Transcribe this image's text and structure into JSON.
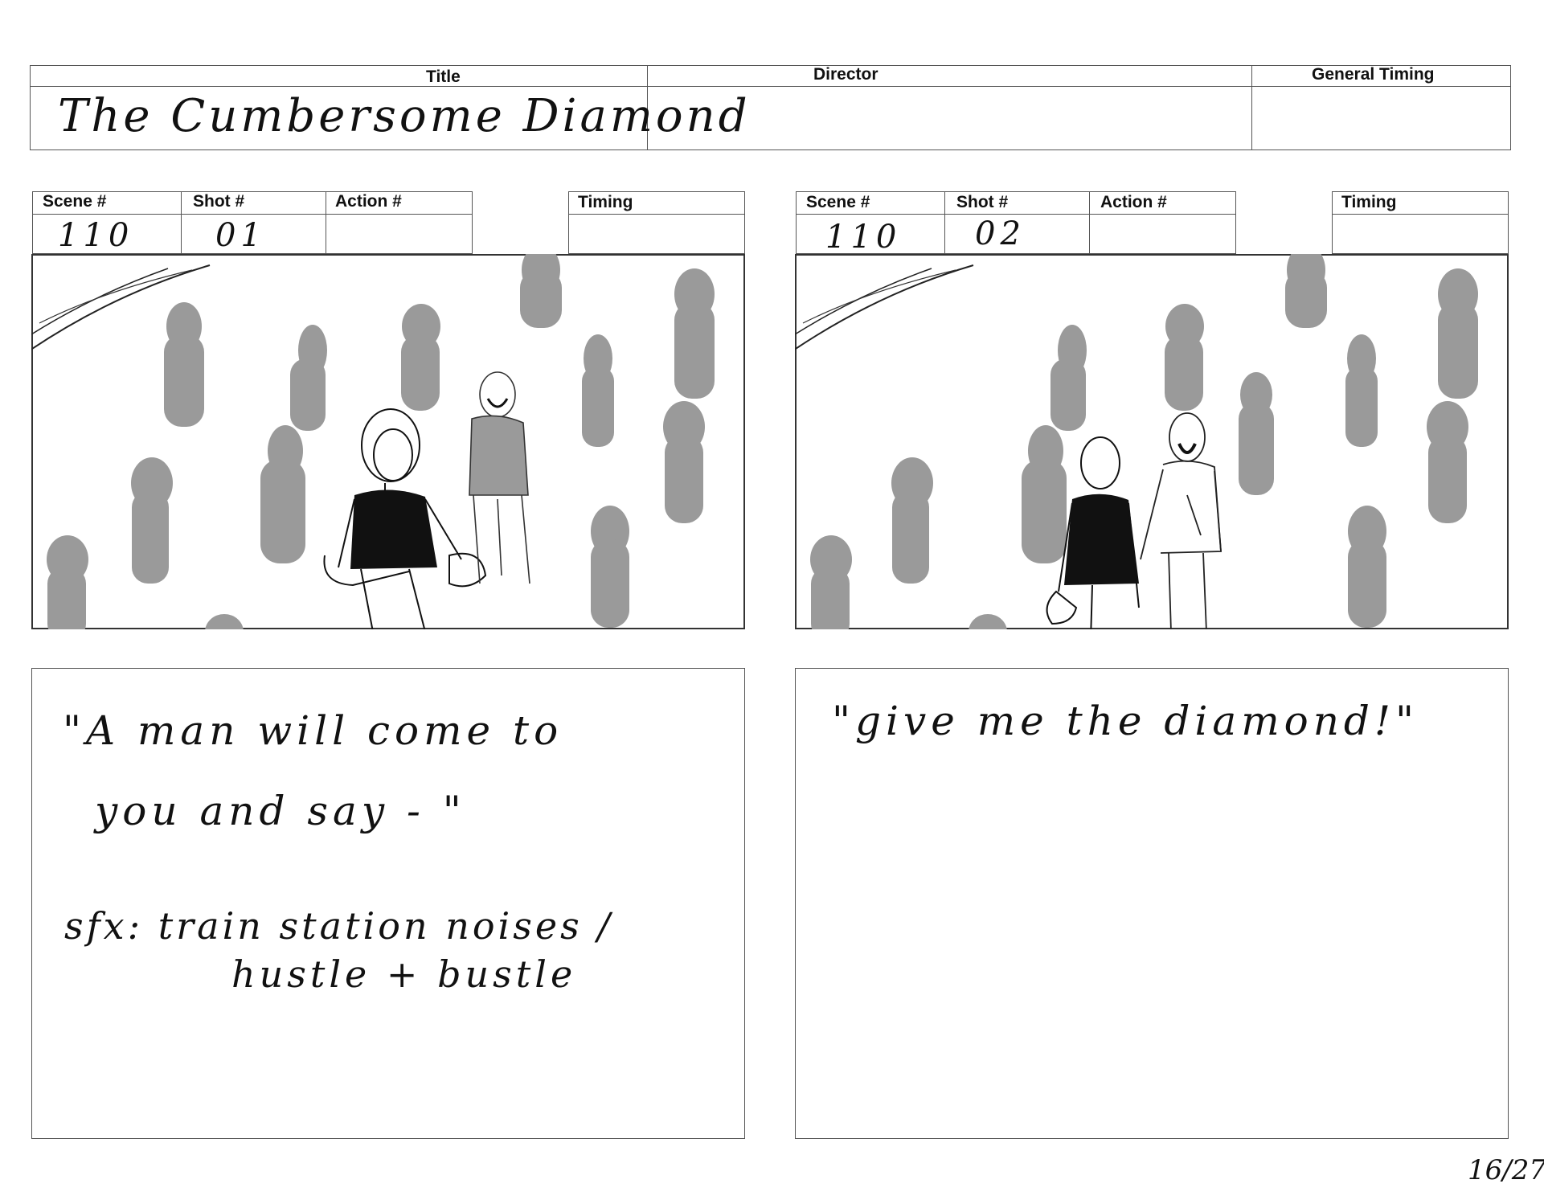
{
  "header": {
    "title_label": "Title",
    "director_label": "Director",
    "general_timing_label": "General Timing",
    "title_value": "The Cumbersome Diamond",
    "director_value": "",
    "general_timing_value": ""
  },
  "panels": [
    {
      "scene_label": "Scene #",
      "shot_label": "Shot #",
      "action_label": "Action #",
      "timing_label": "Timing",
      "scene_value": "110",
      "shot_value": "01",
      "action_value": "",
      "timing_value": "",
      "notes": [
        "\"A man will come to",
        "you and say - \"",
        "sfx: train station noises /",
        "hustle + bustle"
      ]
    },
    {
      "scene_label": "Scene #",
      "shot_label": "Shot #",
      "action_label": "Action #",
      "timing_label": "Timing",
      "scene_value": "110",
      "shot_value": "02",
      "action_value": "",
      "timing_value": "",
      "notes": [
        "\"give me the diamond!\""
      ]
    }
  ],
  "page_number": "16/27"
}
